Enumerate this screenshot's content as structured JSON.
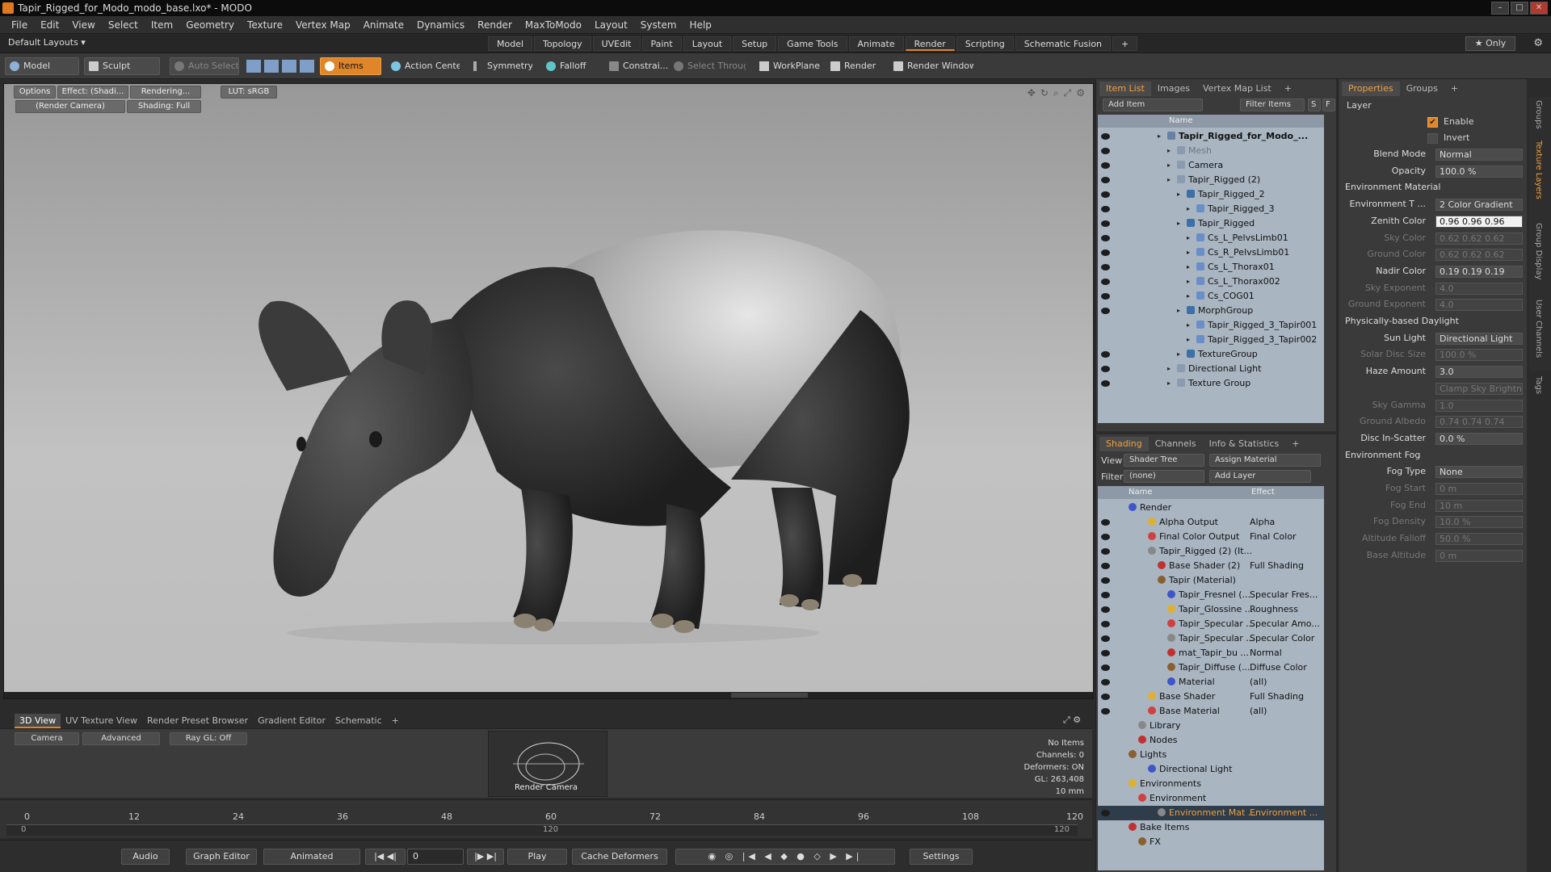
{
  "window": {
    "title": "Tapir_Rigged_for_Modo_modo_base.lxo* - MODO"
  },
  "menu": [
    "File",
    "Edit",
    "View",
    "Select",
    "Item",
    "Geometry",
    "Texture",
    "Vertex Map",
    "Animate",
    "Dynamics",
    "Render",
    "MaxToModo",
    "Layout",
    "System",
    "Help"
  ],
  "layout": {
    "preset": "Default Layouts ▾",
    "tabs": [
      "Model",
      "Topology",
      "UVEdit",
      "Paint",
      "Layout",
      "Setup",
      "Game Tools",
      "Animate",
      "Render",
      "Scripting",
      "Schematic Fusion",
      "+"
    ],
    "active_tab": "Render",
    "only_label": "★ Only"
  },
  "toolbar": {
    "model": "Model",
    "sculpt": "Sculpt",
    "auto_select": "Auto Select",
    "items": "Items",
    "action_center": "Action Center",
    "symmetry": "Symmetry",
    "falloff": "Falloff",
    "constrain": "Constrai...",
    "select_through": "Select Through",
    "workplane": "WorkPlane",
    "render": "Render",
    "render_window": "Render Window"
  },
  "viewport": {
    "options": "Options",
    "effect": "Effect: (Shadi...",
    "rendering": "Rendering...",
    "lut": "LUT: sRGB",
    "camera": "(Render Camera)",
    "shading": "Shading: Full"
  },
  "lower_tabs": [
    "3D View",
    "UV Texture View",
    "Render Preset Browser",
    "Gradient Editor",
    "Schematic",
    "+"
  ],
  "lower_panel": {
    "camera": "Camera",
    "advanced": "Advanced",
    "raygl": "Ray GL: Off",
    "preview_label": "Render Camera",
    "stats": [
      "No Items",
      "Channels: 0",
      "Deformers: ON",
      "GL: 263,408",
      "10 mm"
    ]
  },
  "timeline": {
    "top_ticks": [
      "0",
      "12",
      "24",
      "36",
      "48",
      "60",
      "72",
      "84",
      "96",
      "108",
      "120"
    ],
    "bottom_ticks": [
      "0",
      "120",
      "120"
    ]
  },
  "bottom": {
    "audio": "Audio",
    "graph_editor": "Graph Editor",
    "animated": "Animated",
    "frame": "0",
    "play": "Play",
    "cache_deformers": "Cache Deformers",
    "settings": "Settings"
  },
  "item_list": {
    "tabs": [
      "Item List",
      "Images",
      "Vertex Map List",
      "+"
    ],
    "add_item": "Add Item",
    "filter_items": "Filter Items",
    "col_name": "Name",
    "rows": [
      {
        "label": "Tapir_Rigged_for_Modo_...",
        "indent": 0,
        "eye": true,
        "bold": true
      },
      {
        "label": "Mesh",
        "indent": 1,
        "eye": true,
        "dim": true
      },
      {
        "label": "Camera",
        "indent": 1,
        "eye": true
      },
      {
        "label": "Tapir_Rigged (2)",
        "indent": 1,
        "eye": true
      },
      {
        "label": "Tapir_Rigged_2",
        "indent": 2,
        "eye": true
      },
      {
        "label": "Tapir_Rigged_3",
        "indent": 3,
        "eye": true
      },
      {
        "label": "Tapir_Rigged",
        "indent": 2,
        "eye": true
      },
      {
        "label": "Cs_L_PelvsLimb01",
        "indent": 3,
        "eye": true
      },
      {
        "label": "Cs_R_PelvsLimb01",
        "indent": 3,
        "eye": true
      },
      {
        "label": "Cs_L_Thorax01",
        "indent": 3,
        "eye": true
      },
      {
        "label": "Cs_L_Thorax002",
        "indent": 3,
        "eye": true
      },
      {
        "label": "Cs_COG01",
        "indent": 3,
        "eye": true
      },
      {
        "label": "MorphGroup",
        "indent": 2,
        "eye": true
      },
      {
        "label": "Tapir_Rigged_3_Tapir001",
        "indent": 3,
        "eye": false
      },
      {
        "label": "Tapir_Rigged_3_Tapir002",
        "indent": 3,
        "eye": false
      },
      {
        "label": "TextureGroup",
        "indent": 2,
        "eye": true
      },
      {
        "label": "Directional Light",
        "indent": 1,
        "eye": true
      },
      {
        "label": "Texture Group",
        "indent": 1,
        "eye": true
      }
    ]
  },
  "shading": {
    "tabs": [
      "Shading",
      "Channels",
      "Info & Statistics",
      "+"
    ],
    "view_label": "View",
    "view_value": "Shader Tree",
    "assign_material": "Assign Material",
    "filter_label": "Filter",
    "filter_value": "(none)",
    "add_layer": "Add Layer",
    "col_name": "Name",
    "col_effect": "Effect",
    "rows": [
      {
        "label": "Render",
        "effect": "",
        "indent": 0,
        "eye": false
      },
      {
        "label": "Alpha Output",
        "effect": "Alpha",
        "indent": 2,
        "eye": true
      },
      {
        "label": "Final Color Output",
        "effect": "Final Color",
        "indent": 2,
        "eye": true
      },
      {
        "label": "Tapir_Rigged (2) (It...",
        "effect": "",
        "indent": 2,
        "eye": true
      },
      {
        "label": "Base Shader (2)",
        "effect": "Full Shading",
        "indent": 3,
        "eye": true
      },
      {
        "label": "Tapir (Material)",
        "effect": "",
        "indent": 3,
        "eye": true
      },
      {
        "label": "Tapir_Fresnel (...",
        "effect": "Specular Fres...",
        "indent": 4,
        "eye": true
      },
      {
        "label": "Tapir_Glossine ...",
        "effect": "Roughness",
        "indent": 4,
        "eye": true
      },
      {
        "label": "Tapir_Specular ...",
        "effect": "Specular Amo...",
        "indent": 4,
        "eye": true
      },
      {
        "label": "Tapir_Specular ...",
        "effect": "Specular Color",
        "indent": 4,
        "eye": true
      },
      {
        "label": "mat_Tapir_bu ...",
        "effect": "Normal",
        "indent": 4,
        "eye": true
      },
      {
        "label": "Tapir_Diffuse (...",
        "effect": "Diffuse Color",
        "indent": 4,
        "eye": true
      },
      {
        "label": "Material",
        "effect": "(all)",
        "indent": 4,
        "eye": true
      },
      {
        "label": "Base Shader",
        "effect": "Full Shading",
        "indent": 2,
        "eye": true
      },
      {
        "label": "Base Material",
        "effect": "(all)",
        "indent": 2,
        "eye": true
      },
      {
        "label": "Library",
        "effect": "",
        "indent": 1,
        "eye": false
      },
      {
        "label": "Nodes",
        "effect": "",
        "indent": 1,
        "eye": false
      },
      {
        "label": "Lights",
        "effect": "",
        "indent": 0,
        "eye": false
      },
      {
        "label": "Directional Light",
        "effect": "",
        "indent": 2,
        "eye": false
      },
      {
        "label": "Environments",
        "effect": "",
        "indent": 0,
        "eye": false
      },
      {
        "label": "Environment",
        "effect": "",
        "indent": 1,
        "eye": false
      },
      {
        "label": "Environment Mat ...",
        "effect": "Environment ...",
        "indent": 3,
        "eye": true,
        "selected": true
      },
      {
        "label": "Bake Items",
        "effect": "",
        "indent": 0,
        "eye": false
      },
      {
        "label": "FX",
        "effect": "",
        "indent": 1,
        "eye": false
      }
    ]
  },
  "properties": {
    "tabs": [
      "Properties",
      "Groups",
      "+"
    ],
    "layer_title": "Layer",
    "enable": "Enable",
    "invert": "Invert",
    "rows": [
      {
        "type": "field",
        "label": "Blend Mode",
        "value": "Normal"
      },
      {
        "type": "field",
        "label": "Opacity",
        "value": "100.0 %"
      },
      {
        "type": "section",
        "label": "Environment Material"
      },
      {
        "type": "field",
        "label": "Environment T ...",
        "value": "2 Color Gradient"
      },
      {
        "type": "field",
        "label": "Zenith Color",
        "value": "0.96   0.96   0.96",
        "style": "white"
      },
      {
        "type": "field",
        "label": "Sky Color",
        "value": "0.62   0.62   0.62",
        "dim": true
      },
      {
        "type": "field",
        "label": "Ground Color",
        "value": "0.62   0.62   0.62",
        "dim": true
      },
      {
        "type": "field",
        "label": "Nadir Color",
        "value": "0.19   0.19   0.19"
      },
      {
        "type": "field",
        "label": "Sky Exponent",
        "value": "4.0",
        "dim": true
      },
      {
        "type": "field",
        "label": "Ground Exponent",
        "value": "4.0",
        "dim": true
      },
      {
        "type": "section",
        "label": "Physically-based Daylight"
      },
      {
        "type": "field",
        "label": "Sun Light",
        "value": "Directional Light"
      },
      {
        "type": "field",
        "label": "Solar Disc Size",
        "value": "100.0 %",
        "dim": true
      },
      {
        "type": "field",
        "label": "Haze Amount",
        "value": "3.0"
      },
      {
        "type": "field",
        "label": "",
        "value": "Clamp Sky Brightness",
        "dim": true
      },
      {
        "type": "field",
        "label": "Sky Gamma",
        "value": "1.0",
        "dim": true
      },
      {
        "type": "field",
        "label": "Ground Albedo",
        "value": "0.74   0.74   0.74",
        "dim": true
      },
      {
        "type": "field",
        "label": "Disc In-Scatter",
        "value": "0.0 %"
      },
      {
        "type": "section",
        "label": "Environment Fog"
      },
      {
        "type": "field",
        "label": "Fog Type",
        "value": "None"
      },
      {
        "type": "field",
        "label": "Fog Start",
        "value": "0 m",
        "dim": true
      },
      {
        "type": "field",
        "label": "Fog End",
        "value": "10 m",
        "dim": true
      },
      {
        "type": "field",
        "label": "Fog Density",
        "value": "10.0 %",
        "dim": true
      },
      {
        "type": "field",
        "label": "Altitude Falloff",
        "value": "50.0 %",
        "dim": true
      },
      {
        "type": "field",
        "label": "Base Altitude",
        "value": "0 m",
        "dim": true
      }
    ]
  },
  "side_tabs": [
    "Groups",
    "Texture Layers",
    "Group Display",
    "User Channels",
    "Tags"
  ],
  "colors": {
    "accent": "#e0862a",
    "tree_bg": "#a9b5c1",
    "viewport_top": "#989898"
  }
}
